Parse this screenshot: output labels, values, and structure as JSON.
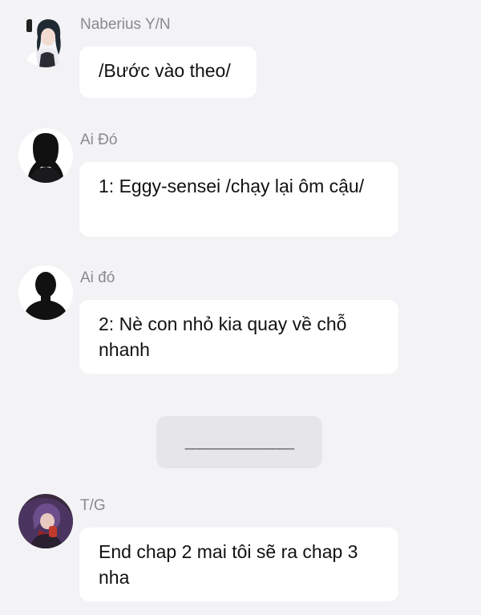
{
  "messages": [
    {
      "name": "Naberius Y/N",
      "text": "/Bước vào theo/",
      "avatar_icon": "anime-girl-avatar-icon"
    },
    {
      "name": "Ai Đó",
      "text": "1: Eggy-sensei /chạy lại ôm cậu/",
      "avatar_icon": "long-hair-silhouette-icon"
    },
    {
      "name": "Ai đó",
      "text": "2: Nè con nhỏ kia quay về chỗ nhanh",
      "avatar_icon": "short-hair-silhouette-icon"
    },
    {
      "name": "T/G",
      "text": "End chap 2 mai tôi sẽ ra chap 3 nha",
      "avatar_icon": "purple-hair-character-avatar-icon"
    }
  ],
  "divider": {
    "text": "_______________"
  },
  "colors": {
    "background": "#f3f3f5",
    "bubble": "#ffffff",
    "name_text": "#8a8a8e",
    "divider_box": "#e6e6e8"
  }
}
